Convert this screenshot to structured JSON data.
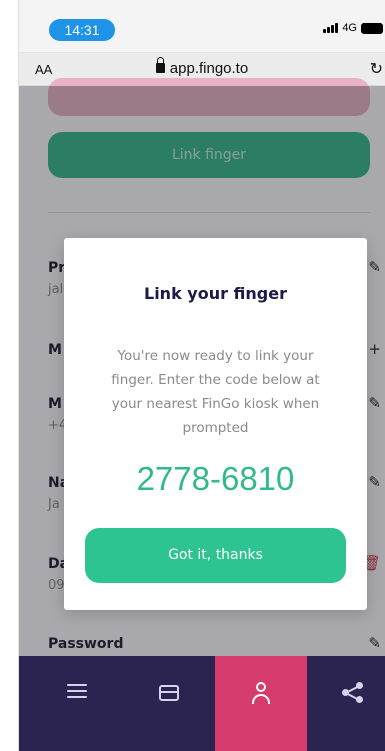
{
  "status_bar": {
    "time": "14:31",
    "network": "4G"
  },
  "browser": {
    "text_size_label": "AA",
    "url": "app.fingo.to",
    "reload_glyph": "↻"
  },
  "page": {
    "link_finger_label": "Link finger",
    "rows": [
      {
        "label": "Pr",
        "value": "jal",
        "action": "✎"
      },
      {
        "label": "M",
        "value": "",
        "action": "+"
      },
      {
        "label": "M",
        "value": "+4",
        "action": "✎"
      },
      {
        "label": "Na",
        "value": "Ja",
        "action": "✎"
      },
      {
        "label": "Da",
        "value": "09",
        "action": "🗑"
      },
      {
        "label": "Password",
        "value": "**************",
        "action": "✎"
      }
    ]
  },
  "modal": {
    "title": "Link your finger",
    "body": "You're now ready to link your finger. Enter the code below at your nearest FinGo kiosk when prompted",
    "code": "2778-6810",
    "button_label": "Got it, thanks"
  },
  "colors": {
    "accent_green": "#34b98d",
    "brand_navy": "#2b2350",
    "active_tab": "#d63c6b",
    "time_pill": "#1e93e8"
  },
  "tab_bar": {
    "items": [
      "menu-icon",
      "card-icon",
      "profile-icon",
      "share-icon"
    ],
    "active": "profile-icon"
  }
}
